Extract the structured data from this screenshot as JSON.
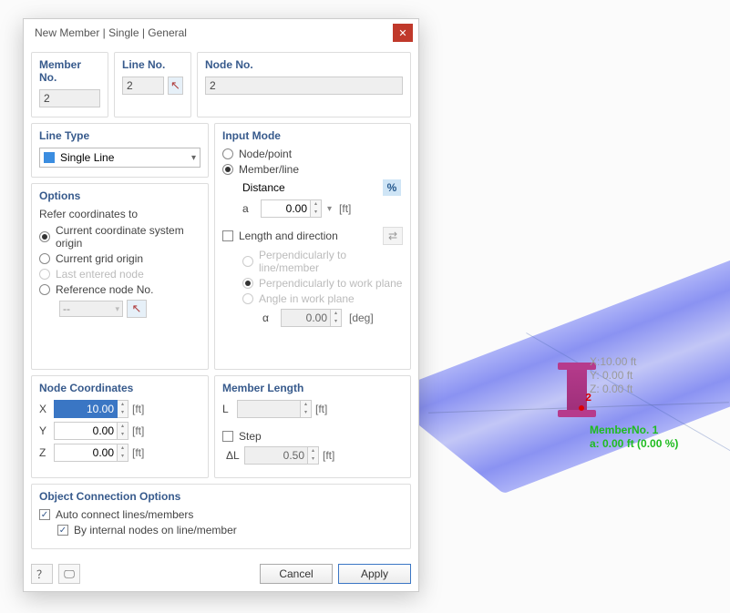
{
  "title": "New Member | Single | General",
  "section_member_no": "Member No.",
  "member_no": "2",
  "section_line_no": "Line No.",
  "line_no": "2",
  "section_node_no": "Node No.",
  "node_no": "2",
  "section_line_type": "Line Type",
  "line_type": "Single Line",
  "section_options": "Options",
  "refer_coords": "Refer coordinates to",
  "opt_cs_origin": "Current coordinate system origin",
  "opt_grid_origin": "Current grid origin",
  "opt_last_node": "Last entered node",
  "opt_ref_node": "Reference node No.",
  "ref_node_val": "--",
  "section_input_mode": "Input Mode",
  "im_node_point": "Node/point",
  "im_member_line": "Member/line",
  "distance_lbl": "Distance",
  "a_lbl": "a",
  "a_val": "0.00",
  "a_unit": "[ft]",
  "length_dir": "Length and direction",
  "perp_line": "Perpendicularly to line/member",
  "perp_work": "Perpendicularly to work plane",
  "angle_work": "Angle in work plane",
  "alpha_lbl": "α",
  "alpha_val": "0.00",
  "alpha_unit": "[deg]",
  "section_coords": "Node Coordinates",
  "x_lbl": "X",
  "x_val": "10.00",
  "x_unit": "[ft]",
  "y_lbl": "Y",
  "y_val": "0.00",
  "y_unit": "[ft]",
  "z_lbl": "Z",
  "z_val": "0.00",
  "z_unit": "[ft]",
  "section_member_len": "Member Length",
  "L_lbl": "L",
  "L_val": "",
  "L_unit": "[ft]",
  "step_lbl": "Step",
  "dL_lbl": "ΔL",
  "dL_val": "0.50",
  "dL_unit": "[ft]",
  "section_conn": "Object Connection Options",
  "auto_connect": "Auto connect lines/members",
  "by_internal": "By internal nodes on line/member",
  "cancel": "Cancel",
  "apply": "Apply",
  "hud": {
    "x": "X:10.00 ft",
    "y": "Y: 0.00 ft",
    "z": "Z: 0.00 ft",
    "member": "MemberNo. 1",
    "a": "a: 0.00 ft (0.00 %)",
    "node2": "2"
  }
}
